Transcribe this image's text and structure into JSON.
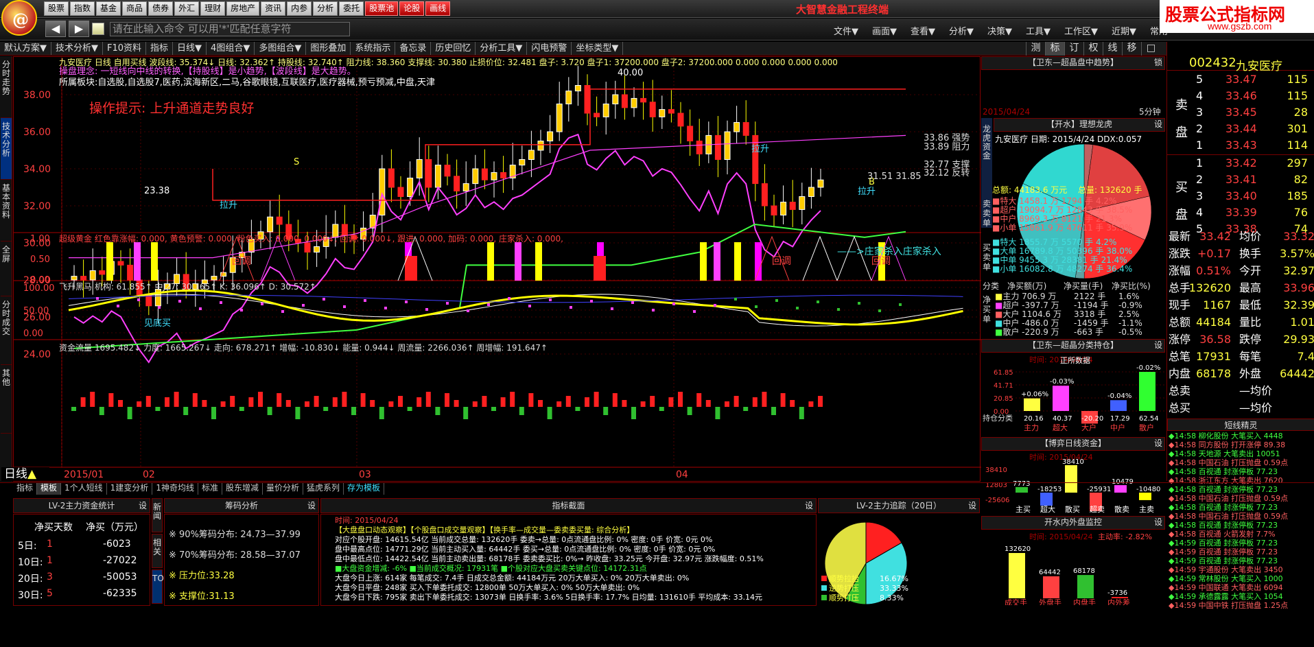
{
  "top_menu": [
    "股票",
    "指数",
    "基金",
    "商品",
    "债券",
    "外汇",
    "理财",
    "房地产",
    "资讯",
    "内参",
    "分析",
    "委托",
    "股票池",
    "论股",
    "画线"
  ],
  "app_title": "大智慧金融工程终端",
  "brand": {
    "main": "股票公式指标网",
    "sub": "www.gszb.com"
  },
  "command_placeholder": "请在此输入命令  可以用'*'匹配任意字符",
  "menu2": [
    "文件▼",
    "画面▼",
    "查看▼",
    "分析▼",
    "决策▼",
    "工具▼",
    "工作区▼",
    "近期▼",
    "常用"
  ],
  "toolbar": [
    "默认方案▼",
    "技术分析▼",
    "F10资料",
    "指标",
    "日线▼",
    "4图组合▼",
    "多图组合▼",
    "图形叠加",
    "系统指示",
    "备忘录",
    "历史回忆",
    "分析工具▼",
    "闪电预警",
    "坐标类型▼"
  ],
  "right_toolbar": [
    "测",
    "标",
    "订",
    "权",
    "线",
    "移",
    "□"
  ],
  "vtabs": [
    "分时走势",
    "技术分析",
    "基本资料",
    "全屏",
    "分时成交",
    "其他"
  ],
  "chart": {
    "stock_line": "九安医疗 日线 自用买线 波段线: 35.374↓ 日线: 32.362↑ 持股线: 32.740↑ 阻力线: 38.360 支撑线: 30.380 止损价位: 32.481 盘子: 3.720 盘子1: 37200.000 盘子2: 37200.000 0.000 0.000 0.000 0.000",
    "concept": "操盘理念: 一短线向中线的转换,【持股线】是小趋势,【波段线】是大趋势。",
    "sectors": "所属板块:自选股,自选股7,医药,滨海新区,二马,谷歌眼镜,互联医疗,医疗器械,预亏预减,中盘,天津",
    "hint": "操作提示: 上升通道走势良好",
    "price_axis": [
      "38.00",
      "36.00",
      "34.00",
      "32.00",
      "30.00",
      "28.00",
      "26.00",
      "24.00"
    ],
    "labels": {
      "top": "40.00",
      "low": "23.38",
      "lashen1": "拉升",
      "lashen2": "拉升",
      "lashen3": "拉升",
      "S": "S",
      "B": "B",
      "zy": "33.89 阻力",
      "zy2": "33.86 强势",
      "zc": "32.77 支撑",
      "zc2": "32.12 反转",
      "bot": "31.51 31.85"
    },
    "ind1_title": "超级黄金 红色靠涨幅: 0.000, 黄色预警: 0.000, 粉色买入: 0.000, 0.000↓, 回调: 0.000↓, 跟进: 0.000, 加码: 0.000, 庄家杀入: 0.000,",
    "ind1_axis": [
      "1.00",
      "0.50",
      "0.00"
    ],
    "ind1_labels": [
      "回调",
      "回调",
      "回调",
      "——>庄家杀入庄家杀入"
    ],
    "ind2_title": "飞升黑马 机构: 61.855↑ 中J27: 30.165↑ K: 36.096↑ D: 30.572↑",
    "ind2_axis": [
      "100.00",
      "50.00",
      "0.00"
    ],
    "ind2_label": "见底买",
    "ind3_title": "资金流量 1695.482↓ 力度: 1665.267↓ 走向: 678.271↑ 增幅: -10.830↓ 能量: 0.944↓ 周流量: 2266.036↑ 周增幅: 191.647↑",
    "date_axis": [
      "2015/01",
      "02",
      "03",
      "04"
    ],
    "period": "日线",
    "bottom_tabs": [
      "指标",
      "模板",
      "1个人短线",
      "1建变分析",
      "1神奇均线",
      "标准",
      "股东增减",
      "量价分析",
      "猛虎系列",
      "存为模板"
    ]
  },
  "rp1": {
    "title": "【卫东—超晶盘中趋势】",
    "btn": "锁",
    "date": "2015/04/24",
    "tail": "5分钟"
  },
  "rp2": {
    "title": "【开水】理想龙虎",
    "btn": "设",
    "line": "九安医疗 日期: 2015/4/24 DDX:0.057",
    "total": "总额: 44183.6 万元",
    "vol": "总量: 132620 手",
    "sell_rows": [
      [
        "特大",
        "1458.1 万",
        "1794 手",
        "4.2%"
      ],
      [
        "超户",
        "19094.7 万",
        "12843 手",
        "38.5%"
      ],
      [
        "中户",
        "8969.3 万",
        "8121 手",
        "21.3%"
      ],
      [
        "小单",
        "15861.9 万",
        "47611 手",
        "35.9%"
      ]
    ],
    "buy_rows": [
      [
        "特大",
        "1855.7 万",
        "5570 手",
        "4.2%"
      ],
      [
        "大单",
        "16789.8 万",
        "50396 手",
        "38.0%"
      ],
      [
        "中单",
        "9455.3 万",
        "28381 手",
        "21.4%"
      ],
      [
        "小单",
        "16082.8 万",
        "48274 手",
        "36.4%"
      ]
    ],
    "side_sell": "卖卖单",
    "side_buy": "买卖单"
  },
  "rp3": {
    "heads": [
      "分类",
      "净买额(万)",
      "净买量(手)",
      "净买比(%)"
    ],
    "side": "净买单",
    "rows": [
      [
        "主力",
        "706.9 万",
        "2122 手",
        "1.6%"
      ],
      [
        "超户",
        "-397.7 万",
        "-1194 手",
        "-0.9%"
      ],
      [
        "大户",
        "1104.6 万",
        "3318 手",
        "2.5%"
      ],
      [
        "中户",
        "-486.0 万",
        "-1459 手",
        "-1.1%"
      ],
      [
        "散户",
        "-220.9 万",
        "-663 手",
        "-0.5%"
      ]
    ]
  },
  "rp4": {
    "title": "【卫东—超晶分类持仓】",
    "btn": "设",
    "date": "时间: 2015/04/24",
    "sub": "正所数据",
    "axis": [
      "61.85",
      "41.71",
      "20.85",
      "0.00"
    ],
    "side": "持仓分类",
    "bars": [
      {
        "name": "主力",
        "val": 20.16,
        "pct": "+0.06%"
      },
      {
        "name": "超大",
        "val": 40.37,
        "pct": "-0.03%"
      },
      {
        "name": "大户",
        "val": -20.2,
        "pct": ""
      },
      {
        "name": "中户",
        "val": 17.29,
        "pct": "-0.04%"
      },
      {
        "name": "散户",
        "val": 62.54,
        "pct": "-0.02%"
      }
    ],
    "vals": [
      "20.16",
      "40.37",
      "-20.20",
      "17.29",
      "62.54"
    ]
  },
  "rp5": {
    "title": "【博弈日线资金】",
    "btn": "设",
    "date": "时间: 2015/04/24",
    "axis": [
      "38410",
      "12803",
      "-25606"
    ],
    "bars": [
      {
        "name": "主买",
        "val": 7773
      },
      {
        "name": "超大",
        "val": -18253
      },
      {
        "name": "散买",
        "val": 38410
      },
      {
        "name": "超卖",
        "val": -25931
      },
      {
        "name": "散卖",
        "val": 10479
      },
      {
        "name": "主卖",
        "val": -10480
      }
    ],
    "labels": [
      "7773",
      "-18253",
      "38410",
      "-25931",
      "10479",
      "-10480"
    ]
  },
  "rp6": {
    "title": "开水内外盘监控",
    "btn": "设",
    "date": "时间: 2015/04/24",
    "ratio": "主动率: -2.82%",
    "bars": [
      {
        "name": "成交手",
        "val": 132620
      },
      {
        "name": "外盘手",
        "val": 64442
      },
      {
        "name": "内盘手",
        "val": 68178
      },
      {
        "name": "内外差",
        "val": -3736
      }
    ],
    "labels": [
      "132620",
      "64442",
      "68178",
      "-3736"
    ]
  },
  "quote": {
    "code": "002432",
    "name": "九安医疗",
    "sell": [
      [
        "5",
        "33.47",
        "115"
      ],
      [
        "4",
        "33.46",
        "115"
      ],
      [
        "3",
        "33.45",
        "28"
      ],
      [
        "2",
        "33.44",
        "301"
      ],
      [
        "1",
        "33.43",
        "114"
      ]
    ],
    "buy": [
      [
        "1",
        "33.42",
        "297"
      ],
      [
        "2",
        "33.41",
        "82"
      ],
      [
        "3",
        "33.40",
        "185"
      ],
      [
        "4",
        "33.39",
        "76"
      ],
      [
        "5",
        "33.38",
        "74"
      ]
    ],
    "sell_label": "卖盘",
    "buy_label": "买盘",
    "stats": [
      [
        "最新",
        "33.42",
        "均价",
        "33.32"
      ],
      [
        "涨跌",
        "+0.17",
        "换手",
        "3.57%"
      ],
      [
        "涨幅",
        "0.51%",
        "今开",
        "32.97"
      ],
      [
        "总手",
        "132620",
        "最高",
        "33.96"
      ],
      [
        "现手",
        "1167",
        "最低",
        "32.39"
      ],
      [
        "总额",
        "44184",
        "量比",
        "1.01"
      ],
      [
        "涨停",
        "36.58",
        "跌停",
        "29.93"
      ],
      [
        "总笔",
        "17931",
        "每笔",
        "7.4"
      ],
      [
        "内盘",
        "68178",
        "外盘",
        "64442"
      ],
      [
        "总卖",
        "",
        "—均价",
        ""
      ],
      [
        "总买",
        "",
        "—均价",
        ""
      ]
    ],
    "elves_title": "短线精灵",
    "elves": [
      [
        "14:58",
        "柳化股份",
        "大笔买入",
        "4448"
      ],
      [
        "14:58",
        "同方股份",
        "打开涨停",
        "89.38"
      ],
      [
        "14:58",
        "天地源",
        "大笔卖出",
        "10051"
      ],
      [
        "14:58",
        "中国石油",
        "打压抛盘",
        "0.59点"
      ],
      [
        "14:58",
        "百视通",
        "封涨停板",
        "77.23"
      ],
      [
        "14:58",
        "浙江东方",
        "大笔卖出",
        "7620"
      ],
      [
        "14:58",
        "百视通",
        "封涨停板",
        "77.23"
      ],
      [
        "14:58",
        "中国石油",
        "打压抛盘",
        "0.59点"
      ],
      [
        "14:58",
        "百视通",
        "封涨停板",
        "77.23"
      ],
      [
        "14:58",
        "中国石油",
        "打压抛盘",
        "0.59点"
      ],
      [
        "14:58",
        "百视通",
        "封涨停板",
        "77.23"
      ],
      [
        "14:58",
        "百视通",
        "火箭发射",
        "7.7%"
      ],
      [
        "14:59",
        "百视通",
        "封涨停板",
        "77.23"
      ],
      [
        "14:59",
        "百视通",
        "封涨停板",
        "77.23"
      ],
      [
        "14:59",
        "百视通",
        "封涨停板",
        "77.23"
      ],
      [
        "14:59",
        "宇通股份",
        "大笔卖出",
        "3450"
      ],
      [
        "14:59",
        "常林股份",
        "大笔买入",
        "1000"
      ],
      [
        "14:59",
        "中国联通",
        "大笔卖出",
        "6094"
      ],
      [
        "14:59",
        "承德露露",
        "大笔买入",
        "1054"
      ],
      [
        "14:59",
        "中国中铁",
        "打压抛盘",
        "1.25点"
      ]
    ]
  },
  "bottom": {
    "p1_title": "LV-2主力资金统计",
    "p1_btn": "设",
    "p1_heads": [
      "净买天数",
      "净买（万元）"
    ],
    "p1_rows": [
      [
        "5日:",
        "1",
        "-6023"
      ],
      [
        "10日:",
        "1",
        "-27022"
      ],
      [
        "20日:",
        "3",
        "-50053"
      ],
      [
        "30日:",
        "5",
        "-62335"
      ]
    ],
    "p1_side": [
      "新闻",
      "相关",
      "TOP"
    ],
    "p2_title": "筹码分析",
    "p2_btn": "设",
    "p2_rows": [
      "※  90%筹码分布: 24.73—37.99",
      "※  70%筹码分布: 28.58—37.07",
      "※  压力位:33.28",
      "※  支撑位:31.13"
    ],
    "p3_title": "指标截面",
    "p3_btn": "设",
    "p3_lines": [
      {
        "t": "时间: 2015/04/24",
        "cls": "r"
      },
      {
        "t": "【大盘盘口动态观察】【个股盘口成交量观察】【换手率—成交量—委卖委买量: 综合分析】",
        "cls": "y"
      },
      {
        "t": "对应个股开盘: 14615.54亿  当前成交总量: 132620手   委卖→总量: 0点流通盘比例: 0%  密度: 0手  价宽: 0元  0%",
        "cls": "w"
      },
      {
        "t": "盘中最高点位: 14771.29亿  当前主动买入量: 64442手   委买→总量: 0点流通盘比例: 0%  密度: 0手  价宽: 0元  0%",
        "cls": "w"
      },
      {
        "t": "盘中最低点位: 14422.54亿  当前主动卖出量: 68178手   委卖委买比: 0%→                 昨收盘: 33.25元   今开盘: 32.97元   涨跌幅度: 0.51%",
        "cls": "w"
      },
      {
        "t": "■大盘资金增减: -6%   ■当前成交概况: 17931笔  ■个股对应大盘买卖关键点位: 14172.31点",
        "cls": "g"
      },
      {
        "t": "大盘今日上涨: 614家  每笔成交: 7.4手    日成交总金额: 44184万元       20万大单买入: 0%     20万大单卖出: 0%",
        "cls": "w"
      },
      {
        "t": "大盘今日平盘: 248家  买入下单委托成交: 12800单                          50万大单买入: 0%     50万大单卖出: 0%",
        "cls": "w"
      },
      {
        "t": "大盘今日下跌: 795家  卖出下单委托成交: 13073单  日换手率: 3.6%  5日换手率: 17.7%  日均量: 131610手  平均成本: 33.14元",
        "cls": "w"
      }
    ],
    "p4_title": "LV-2主力追踪（20日）",
    "p4_btn": "设",
    "p4_pie": [
      {
        "name": "顺势拉抬",
        "value": 16.67,
        "color": "#ff2020"
      },
      {
        "name": "逆势打压",
        "value": 33.33,
        "color": "#40e0e0"
      },
      {
        "name": "顺势打压",
        "value": 8.33,
        "color": "#30c030"
      },
      {
        "name": "逆势拉抬",
        "value": 41.67,
        "color": "#e0e040"
      }
    ],
    "p4_labels": [
      "顺势拉抬",
      "逆势打压",
      "顺势打压"
    ],
    "p4_pct": [
      "16.67%",
      "33.33%",
      "8.33%"
    ]
  },
  "rp2_pie": [
    {
      "value": 4.2,
      "color": "#c06060"
    },
    {
      "value": 38.5,
      "color": "#e04040"
    },
    {
      "value": 21.3,
      "color": "#ff7070"
    },
    {
      "value": 35.9,
      "color": "#ff3030"
    },
    {
      "value": 4.2,
      "color": "#60a0a0"
    },
    {
      "value": 38.0,
      "color": "#40c0c0"
    },
    {
      "value": 21.4,
      "color": "#40e0e0"
    },
    {
      "value": 36.4,
      "color": "#30d8d0"
    }
  ]
}
